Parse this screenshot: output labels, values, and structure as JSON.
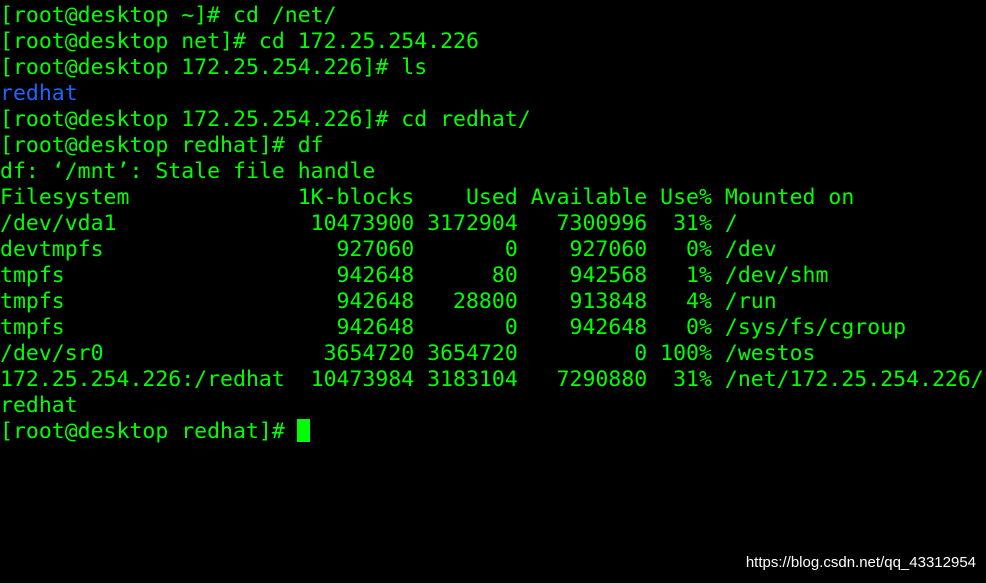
{
  "terminal": {
    "lines": [
      "[root@desktop ~]# cd /net/",
      "[root@desktop net]# cd 172.25.254.226",
      "[root@desktop 172.25.254.226]# ls",
      "redhat",
      "[root@desktop 172.25.254.226]# cd redhat/",
      "[root@desktop redhat]# df",
      "df: ‘/mnt’: Stale file handle",
      "Filesystem             1K-blocks    Used Available Use% Mounted on",
      "/dev/vda1               10473900 3172904   7300996  31% /",
      "devtmpfs                  927060       0    927060   0% /dev",
      "tmpfs                     942648      80    942568   1% /dev/shm",
      "tmpfs                     942648   28800    913848   4% /run",
      "tmpfs                     942648       0    942648   0% /sys/fs/cgroup",
      "/dev/sr0                 3654720 3654720         0 100% /westos",
      "172.25.254.226:/redhat  10473984 3183104   7290880  31% /net/172.25.254.226/",
      "redhat",
      "[root@desktop redhat]# "
    ],
    "colors": {
      "background": "#000000",
      "text": "#00ff00",
      "directory": "#1e64ff",
      "cursor": "#00ff00"
    }
  },
  "watermark": {
    "text": "https://blog.csdn.net/qq_43312954"
  }
}
